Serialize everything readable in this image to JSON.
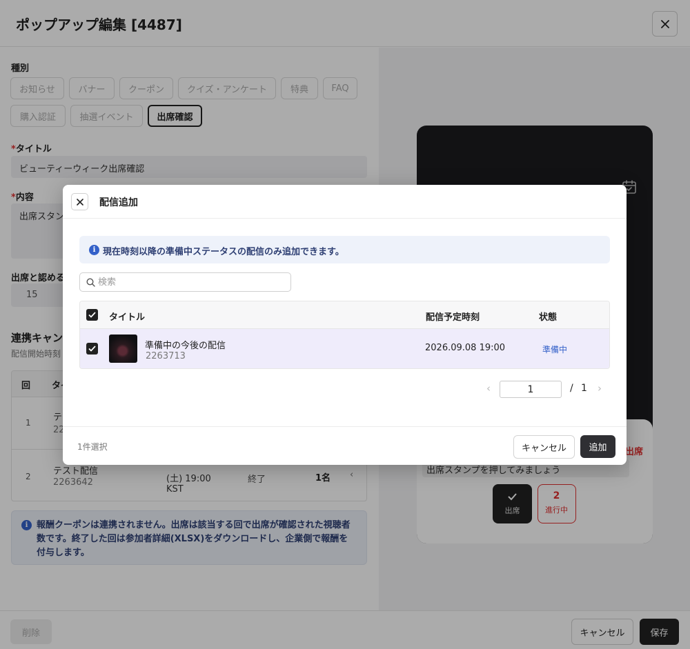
{
  "header": {
    "title": "ポップアップ編集 [4487]"
  },
  "form": {
    "type_label": "種別",
    "type_options": [
      "お知らせ",
      "バナー",
      "クーポン",
      "クイズ・アンケート",
      "特典",
      "FAQ",
      "購入認証",
      "抽選イベント",
      "出席確認"
    ],
    "title_label": "タイトル",
    "title_value": "ビューティーウィーク出席確認",
    "content_label": "内容",
    "content_value": "出席スタン",
    "attendance_label": "出席と認める",
    "attendance_value": "15",
    "linked_label": "連携キャン",
    "linked_sub": "配信開始時刻",
    "table": {
      "col_round": "回",
      "col_title": "タイ",
      "rows": [
        {
          "round": "1",
          "title": "テ",
          "id": "226",
          "date": "",
          "status": "",
          "count": ""
        },
        {
          "round": "2",
          "title": "テスト配信",
          "id": "2263642",
          "date": "(土) 19:00",
          "tz": "KST",
          "status": "終了",
          "count": "1名"
        }
      ]
    },
    "notice": "報酬クーポンは連携されません。出席は該当する回で出席が確認された視聴者数です。終了した回は参加者詳細(XLSX)をダウンロードし、企業側で報酬を付与します。"
  },
  "preview": {
    "label_attend": "出席",
    "message": "出席スタンプを押してみましょう",
    "stamp_label": "出席",
    "progress_number": "2",
    "progress_label": "進行中"
  },
  "footer": {
    "delete": "削除",
    "cancel": "キャンセル",
    "save": "保存"
  },
  "modal": {
    "title": "配信追加",
    "info": "現在時刻以降の準備中ステータスの配信のみ追加できます。",
    "search_placeholder": "検索",
    "columns": {
      "title": "タイトル",
      "scheduled": "配信予定時刻",
      "status": "状態"
    },
    "rows": [
      {
        "title": "準備中の今後の配信",
        "id": "2263713",
        "scheduled": "2026.09.08 19:00",
        "status": "準備中"
      }
    ],
    "pager": {
      "current": "1",
      "separator": "/",
      "total": "1"
    },
    "selected_count": "1件選択",
    "cancel": "キャンセル",
    "add": "追加"
  },
  "colors": {
    "accent_dark": "#222222",
    "info_text": "#2e3f73",
    "info_bg": "#eef2fa",
    "row_selected": "#efecfb",
    "status_blue": "#3461c9",
    "danger": "#e03131"
  }
}
